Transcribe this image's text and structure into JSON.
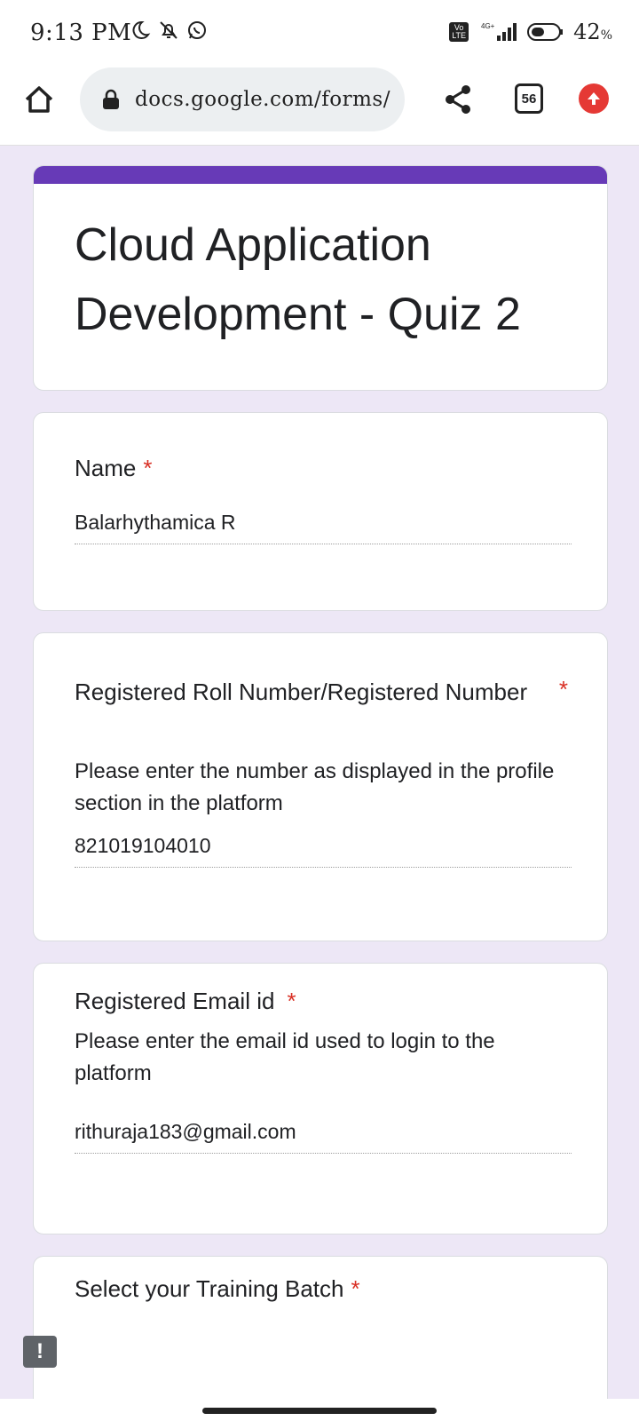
{
  "status_bar": {
    "time": "9:13 PM",
    "network": "4G+",
    "volte": "Vo LTE",
    "battery": "42",
    "battery_unit": "%"
  },
  "browser": {
    "url": "docs.google.com/forms/",
    "tab_count": "56"
  },
  "form": {
    "title": "Cloud Application Development - Quiz 2",
    "accent_color": "#673ab7",
    "questions": [
      {
        "title": "Name",
        "required_mark": "*",
        "answer": "Balarhythamica R"
      },
      {
        "title": "Registered Roll Number/Registered Number",
        "required_mark": "*",
        "help": "Please enter the number as displayed in the profile section in the platform",
        "answer": "821019104010"
      },
      {
        "title": "Registered Email id",
        "required_mark": "*",
        "help": "Please enter the email id used to login to the platform",
        "answer": "rithuraja183@gmail.com"
      },
      {
        "title": "Select your Training Batch",
        "required_mark": "*"
      }
    ]
  },
  "feedback": {
    "label": "!"
  }
}
